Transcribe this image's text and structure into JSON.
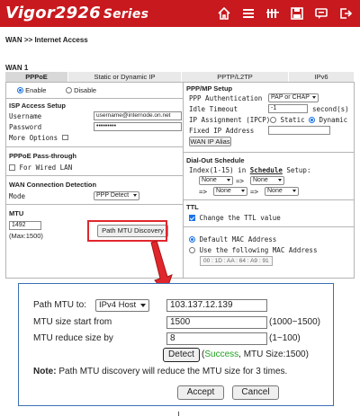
{
  "header": {
    "brand": "Vigor2926",
    "series": "Series",
    "icons": [
      "home-icon",
      "menu-icon",
      "bars-icon",
      "save-icon",
      "chat-icon",
      "logout-icon"
    ],
    "bg_color": "#c8191e"
  },
  "breadcrumb": "WAN >> Internet Access",
  "wan_label": "WAN 1",
  "tabs": [
    {
      "label": "PPPoE",
      "active": true
    },
    {
      "label": "Static or Dynamic IP",
      "active": false
    },
    {
      "label": "PPTP/L2TP",
      "active": false
    },
    {
      "label": "IPv6",
      "active": false
    }
  ],
  "left": {
    "enable": "Enable",
    "disable": "Disable",
    "isp_title": "ISP Access Setup",
    "username_label": "Username",
    "username_value": "username@internode.on.net",
    "password_label": "Password",
    "password_value": "•••••••••",
    "more_options": "More Options",
    "pass_title": "PPPoE Pass-through",
    "for_wired": "For Wired LAN",
    "detect_title": "WAN Connection Detection",
    "mode_label": "Mode",
    "mode_value": "PPP Detect",
    "mtu_title": "MTU",
    "mtu_value": "1492",
    "mtu_max": "(Max:1500)",
    "path_mtu_button": "Path MTU Discovery"
  },
  "right": {
    "ppp_title": "PPP/MP Setup",
    "auth_label": "PPP Authentication",
    "auth_value": "PAP or CHAP",
    "idle_label": "Idle Timeout",
    "idle_value": "-1",
    "idle_unit": "second(s)",
    "ipassign_label": "IP Assignment (IPCP)",
    "static": "Static",
    "dynamic": "Dynamic",
    "fixed_ip_label": "Fixed IP Address",
    "wan_ip_alias": "WAN IP Alias",
    "dialout_title": "Dial-Out Schedule",
    "index_text": "Index(1-15) in",
    "schedule_link": "Schedule",
    "setup_text": "Setup:",
    "none": "None",
    "arrow": "=>",
    "ttl_title": "TTL",
    "ttl_change": "Change the TTL value",
    "default_mac": "Default MAC Address",
    "use_mac": "Use the following MAC Address",
    "mac": [
      "00",
      "1D",
      "AA",
      "64",
      "A9",
      "91"
    ]
  },
  "dialog": {
    "path_mtu_label": "Path MTU to:",
    "ip_version": "IPv4 Host",
    "host_value": "103.137.12.139",
    "start_label": "MTU size start from",
    "start_value": "1500",
    "start_range": "(1000~1500)",
    "reduce_label": "MTU reduce size by",
    "reduce_value": "8",
    "reduce_range": "(1~100)",
    "detect_button": "Detect",
    "result_success": "Success",
    "result_rest": ", MTU Size:1500)",
    "note_label": "Note:",
    "note_text": "Path MTU discovery will reduce the MTU size for 3 times.",
    "accept_button": "Accept",
    "cancel_button": "Cancel"
  }
}
